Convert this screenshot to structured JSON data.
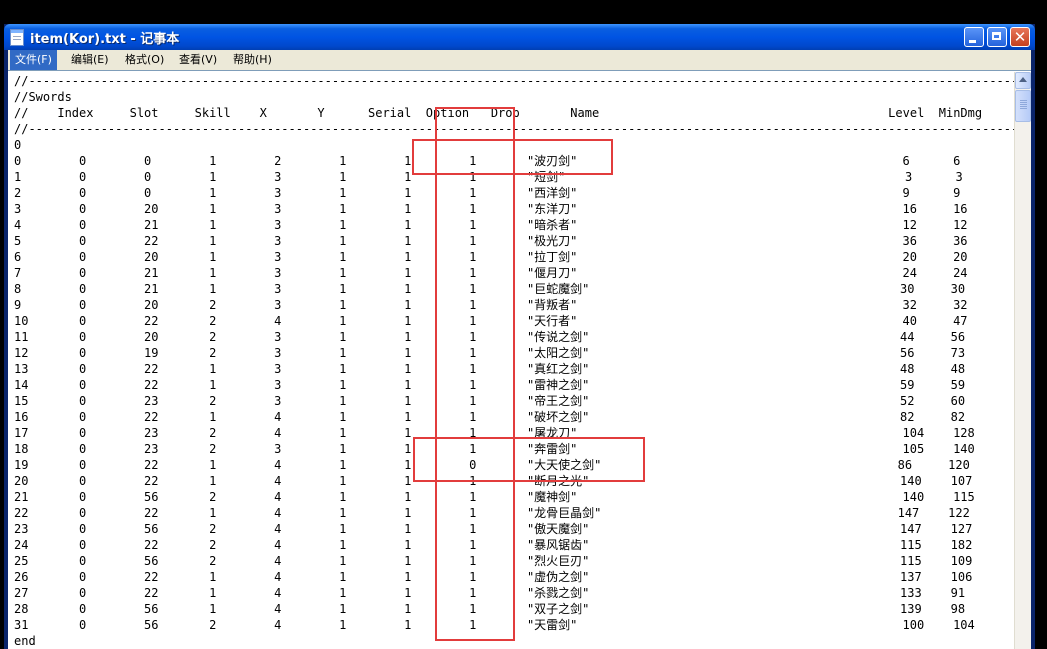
{
  "window": {
    "title": "item(Kor).txt - 记事本"
  },
  "menu": [
    {
      "label": "文件(F)",
      "active": true
    },
    {
      "label": "编辑(E)"
    },
    {
      "label": "格式(O)"
    },
    {
      "label": "查看(V)"
    },
    {
      "label": "帮助(H)"
    }
  ],
  "colors": {
    "highlight_box": "#e23c3c",
    "titlebar": "#0054e3",
    "menu_active": "#316ac5"
  },
  "document": {
    "section": "//Swords",
    "columns": [
      "Index",
      "Slot",
      "Skill",
      "X",
      "Y",
      "Serial",
      "Option",
      "Drop",
      "Name",
      "Level",
      "MinDmg"
    ],
    "header_prefix": "//",
    "type_line": "0",
    "rows": [
      {
        "id": "0",
        "index": "0",
        "slot": "0",
        "skill": "1",
        "x": "2",
        "y": "1",
        "serial": "1",
        "option": "1",
        "name": "\"波刃剑\"",
        "level": "6",
        "mindmg": "6"
      },
      {
        "id": "1",
        "index": "0",
        "slot": "0",
        "skill": "1",
        "x": "3",
        "y": "1",
        "serial": "1",
        "option": "1",
        "name": "\"短剑\"",
        "level": "3",
        "mindmg": "3"
      },
      {
        "id": "2",
        "index": "0",
        "slot": "0",
        "skill": "1",
        "x": "3",
        "y": "1",
        "serial": "1",
        "option": "1",
        "name": "\"西洋剑\"",
        "level": "9",
        "mindmg": "9"
      },
      {
        "id": "3",
        "index": "0",
        "slot": "20",
        "skill": "1",
        "x": "3",
        "y": "1",
        "serial": "1",
        "option": "1",
        "name": "\"东洋刀\"",
        "level": "16",
        "mindmg": "16"
      },
      {
        "id": "4",
        "index": "0",
        "slot": "21",
        "skill": "1",
        "x": "3",
        "y": "1",
        "serial": "1",
        "option": "1",
        "name": "\"暗杀者\"",
        "level": "12",
        "mindmg": "12"
      },
      {
        "id": "5",
        "index": "0",
        "slot": "22",
        "skill": "1",
        "x": "3",
        "y": "1",
        "serial": "1",
        "option": "1",
        "name": "\"极光刀\"",
        "level": "36",
        "mindmg": "36"
      },
      {
        "id": "6",
        "index": "0",
        "slot": "20",
        "skill": "1",
        "x": "3",
        "y": "1",
        "serial": "1",
        "option": "1",
        "name": "\"拉丁剑\"",
        "level": "20",
        "mindmg": "20"
      },
      {
        "id": "7",
        "index": "0",
        "slot": "21",
        "skill": "1",
        "x": "3",
        "y": "1",
        "serial": "1",
        "option": "1",
        "name": "\"偃月刀\"",
        "level": "24",
        "mindmg": "24"
      },
      {
        "id": "8",
        "index": "0",
        "slot": "21",
        "skill": "1",
        "x": "3",
        "y": "1",
        "serial": "1",
        "option": "1",
        "name": "\"巨蛇魔剑\"",
        "level": "30",
        "mindmg": "30"
      },
      {
        "id": "9",
        "index": "0",
        "slot": "20",
        "skill": "2",
        "x": "3",
        "y": "1",
        "serial": "1",
        "option": "1",
        "name": "\"背叛者\"",
        "level": "32",
        "mindmg": "32"
      },
      {
        "id": "10",
        "index": "0",
        "slot": "22",
        "skill": "2",
        "x": "4",
        "y": "1",
        "serial": "1",
        "option": "1",
        "name": "\"天行者\"",
        "level": "40",
        "mindmg": "47"
      },
      {
        "id": "11",
        "index": "0",
        "slot": "20",
        "skill": "2",
        "x": "3",
        "y": "1",
        "serial": "1",
        "option": "1",
        "name": "\"传说之剑\"",
        "level": "44",
        "mindmg": "56"
      },
      {
        "id": "12",
        "index": "0",
        "slot": "19",
        "skill": "2",
        "x": "3",
        "y": "1",
        "serial": "1",
        "option": "1",
        "name": "\"太阳之剑\"",
        "level": "56",
        "mindmg": "73"
      },
      {
        "id": "13",
        "index": "0",
        "slot": "22",
        "skill": "1",
        "x": "3",
        "y": "1",
        "serial": "1",
        "option": "1",
        "name": "\"真红之剑\"",
        "level": "48",
        "mindmg": "48"
      },
      {
        "id": "14",
        "index": "0",
        "slot": "22",
        "skill": "1",
        "x": "3",
        "y": "1",
        "serial": "1",
        "option": "1",
        "name": "\"雷神之剑\"",
        "level": "59",
        "mindmg": "59"
      },
      {
        "id": "15",
        "index": "0",
        "slot": "23",
        "skill": "2",
        "x": "3",
        "y": "1",
        "serial": "1",
        "option": "1",
        "name": "\"帝王之剑\"",
        "level": "52",
        "mindmg": "60"
      },
      {
        "id": "16",
        "index": "0",
        "slot": "22",
        "skill": "1",
        "x": "4",
        "y": "1",
        "serial": "1",
        "option": "1",
        "name": "\"破坏之剑\"",
        "level": "82",
        "mindmg": "82"
      },
      {
        "id": "17",
        "index": "0",
        "slot": "23",
        "skill": "2",
        "x": "4",
        "y": "1",
        "serial": "1",
        "option": "1",
        "name": "\"屠龙刀\"",
        "level": "104",
        "mindmg": "128"
      },
      {
        "id": "18",
        "index": "0",
        "slot": "23",
        "skill": "2",
        "x": "3",
        "y": "1",
        "serial": "1",
        "option": "1",
        "name": "\"奔雷剑\"",
        "level": "105",
        "mindmg": "140"
      },
      {
        "id": "19",
        "index": "0",
        "slot": "22",
        "skill": "1",
        "x": "4",
        "y": "1",
        "serial": "1",
        "option": "0",
        "name": "\"大天使之剑\"",
        "level": "86",
        "mindmg": "120"
      },
      {
        "id": "20",
        "index": "0",
        "slot": "22",
        "skill": "1",
        "x": "4",
        "y": "1",
        "serial": "1",
        "option": "1",
        "name": "\"断月之光\"",
        "level": "140",
        "mindmg": "107"
      },
      {
        "id": "21",
        "index": "0",
        "slot": "56",
        "skill": "2",
        "x": "4",
        "y": "1",
        "serial": "1",
        "option": "1",
        "name": "\"魔神剑\"",
        "level": "140",
        "mindmg": "115"
      },
      {
        "id": "22",
        "index": "0",
        "slot": "22",
        "skill": "1",
        "x": "4",
        "y": "1",
        "serial": "1",
        "option": "1",
        "name": "\"龙骨巨晶剑\"",
        "level": "147",
        "mindmg": "122"
      },
      {
        "id": "23",
        "index": "0",
        "slot": "56",
        "skill": "2",
        "x": "4",
        "y": "1",
        "serial": "1",
        "option": "1",
        "name": "\"傲天魔剑\"",
        "level": "147",
        "mindmg": "127"
      },
      {
        "id": "24",
        "index": "0",
        "slot": "22",
        "skill": "2",
        "x": "4",
        "y": "1",
        "serial": "1",
        "option": "1",
        "name": "\"暴风锯齿\"",
        "level": "115",
        "mindmg": "182"
      },
      {
        "id": "25",
        "index": "0",
        "slot": "56",
        "skill": "2",
        "x": "4",
        "y": "1",
        "serial": "1",
        "option": "1",
        "name": "\"烈火巨刃\"",
        "level": "115",
        "mindmg": "109"
      },
      {
        "id": "26",
        "index": "0",
        "slot": "22",
        "skill": "1",
        "x": "4",
        "y": "1",
        "serial": "1",
        "option": "1",
        "name": "\"虚伪之剑\"",
        "level": "137",
        "mindmg": "106"
      },
      {
        "id": "27",
        "index": "0",
        "slot": "22",
        "skill": "1",
        "x": "4",
        "y": "1",
        "serial": "1",
        "option": "1",
        "name": "\"杀戮之剑\"",
        "level": "133",
        "mindmg": "91"
      },
      {
        "id": "28",
        "index": "0",
        "slot": "56",
        "skill": "1",
        "x": "4",
        "y": "1",
        "serial": "1",
        "option": "1",
        "name": "\"双子之剑\"",
        "level": "139",
        "mindmg": "98"
      },
      {
        "id": "31",
        "index": "0",
        "slot": "56",
        "skill": "2",
        "x": "4",
        "y": "1",
        "serial": "1",
        "option": "1",
        "name": "\"天雷剑\"",
        "level": "100",
        "mindmg": "104"
      }
    ],
    "end": "end"
  }
}
